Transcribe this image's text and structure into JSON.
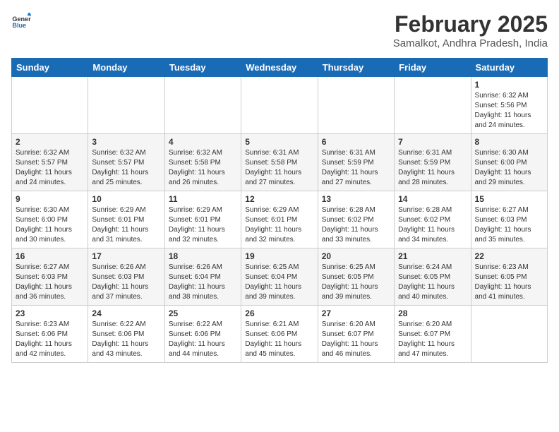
{
  "logo": {
    "line1": "General",
    "line2": "Blue"
  },
  "title": "February 2025",
  "subtitle": "Samalkot, Andhra Pradesh, India",
  "weekdays": [
    "Sunday",
    "Monday",
    "Tuesday",
    "Wednesday",
    "Thursday",
    "Friday",
    "Saturday"
  ],
  "weeks": [
    [
      {
        "day": "",
        "info": ""
      },
      {
        "day": "",
        "info": ""
      },
      {
        "day": "",
        "info": ""
      },
      {
        "day": "",
        "info": ""
      },
      {
        "day": "",
        "info": ""
      },
      {
        "day": "",
        "info": ""
      },
      {
        "day": "1",
        "info": "Sunrise: 6:32 AM\nSunset: 5:56 PM\nDaylight: 11 hours\nand 24 minutes."
      }
    ],
    [
      {
        "day": "2",
        "info": "Sunrise: 6:32 AM\nSunset: 5:57 PM\nDaylight: 11 hours\nand 24 minutes."
      },
      {
        "day": "3",
        "info": "Sunrise: 6:32 AM\nSunset: 5:57 PM\nDaylight: 11 hours\nand 25 minutes."
      },
      {
        "day": "4",
        "info": "Sunrise: 6:32 AM\nSunset: 5:58 PM\nDaylight: 11 hours\nand 26 minutes."
      },
      {
        "day": "5",
        "info": "Sunrise: 6:31 AM\nSunset: 5:58 PM\nDaylight: 11 hours\nand 27 minutes."
      },
      {
        "day": "6",
        "info": "Sunrise: 6:31 AM\nSunset: 5:59 PM\nDaylight: 11 hours\nand 27 minutes."
      },
      {
        "day": "7",
        "info": "Sunrise: 6:31 AM\nSunset: 5:59 PM\nDaylight: 11 hours\nand 28 minutes."
      },
      {
        "day": "8",
        "info": "Sunrise: 6:30 AM\nSunset: 6:00 PM\nDaylight: 11 hours\nand 29 minutes."
      }
    ],
    [
      {
        "day": "9",
        "info": "Sunrise: 6:30 AM\nSunset: 6:00 PM\nDaylight: 11 hours\nand 30 minutes."
      },
      {
        "day": "10",
        "info": "Sunrise: 6:29 AM\nSunset: 6:01 PM\nDaylight: 11 hours\nand 31 minutes."
      },
      {
        "day": "11",
        "info": "Sunrise: 6:29 AM\nSunset: 6:01 PM\nDaylight: 11 hours\nand 32 minutes."
      },
      {
        "day": "12",
        "info": "Sunrise: 6:29 AM\nSunset: 6:01 PM\nDaylight: 11 hours\nand 32 minutes."
      },
      {
        "day": "13",
        "info": "Sunrise: 6:28 AM\nSunset: 6:02 PM\nDaylight: 11 hours\nand 33 minutes."
      },
      {
        "day": "14",
        "info": "Sunrise: 6:28 AM\nSunset: 6:02 PM\nDaylight: 11 hours\nand 34 minutes."
      },
      {
        "day": "15",
        "info": "Sunrise: 6:27 AM\nSunset: 6:03 PM\nDaylight: 11 hours\nand 35 minutes."
      }
    ],
    [
      {
        "day": "16",
        "info": "Sunrise: 6:27 AM\nSunset: 6:03 PM\nDaylight: 11 hours\nand 36 minutes."
      },
      {
        "day": "17",
        "info": "Sunrise: 6:26 AM\nSunset: 6:03 PM\nDaylight: 11 hours\nand 37 minutes."
      },
      {
        "day": "18",
        "info": "Sunrise: 6:26 AM\nSunset: 6:04 PM\nDaylight: 11 hours\nand 38 minutes."
      },
      {
        "day": "19",
        "info": "Sunrise: 6:25 AM\nSunset: 6:04 PM\nDaylight: 11 hours\nand 39 minutes."
      },
      {
        "day": "20",
        "info": "Sunrise: 6:25 AM\nSunset: 6:05 PM\nDaylight: 11 hours\nand 39 minutes."
      },
      {
        "day": "21",
        "info": "Sunrise: 6:24 AM\nSunset: 6:05 PM\nDaylight: 11 hours\nand 40 minutes."
      },
      {
        "day": "22",
        "info": "Sunrise: 6:23 AM\nSunset: 6:05 PM\nDaylight: 11 hours\nand 41 minutes."
      }
    ],
    [
      {
        "day": "23",
        "info": "Sunrise: 6:23 AM\nSunset: 6:06 PM\nDaylight: 11 hours\nand 42 minutes."
      },
      {
        "day": "24",
        "info": "Sunrise: 6:22 AM\nSunset: 6:06 PM\nDaylight: 11 hours\nand 43 minutes."
      },
      {
        "day": "25",
        "info": "Sunrise: 6:22 AM\nSunset: 6:06 PM\nDaylight: 11 hours\nand 44 minutes."
      },
      {
        "day": "26",
        "info": "Sunrise: 6:21 AM\nSunset: 6:06 PM\nDaylight: 11 hours\nand 45 minutes."
      },
      {
        "day": "27",
        "info": "Sunrise: 6:20 AM\nSunset: 6:07 PM\nDaylight: 11 hours\nand 46 minutes."
      },
      {
        "day": "28",
        "info": "Sunrise: 6:20 AM\nSunset: 6:07 PM\nDaylight: 11 hours\nand 47 minutes."
      },
      {
        "day": "",
        "info": ""
      }
    ]
  ]
}
